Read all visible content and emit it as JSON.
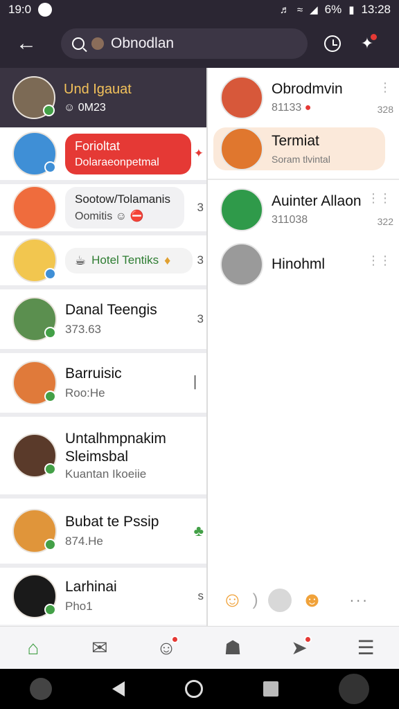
{
  "status_bar": {
    "time": "19:0",
    "battery": "6%",
    "clock": "13:28"
  },
  "app_bar": {
    "search_text": "Obnodlan"
  },
  "left_header": {
    "name": "Und Igauat",
    "sub": "0M23"
  },
  "left_rows": [
    {
      "bubble_title": "Forioltat",
      "bubble_sub": "Dolaraeonpetmal",
      "trail": "✦",
      "avatar_color": "#3f8fd6",
      "status_color": "#3f8fd6"
    },
    {
      "bubble_title": "Sootow/Tolamanis",
      "bubble_sub": "Oomitis",
      "trail": "3",
      "avatar_color": "#ef6c3d",
      "status_color": ""
    },
    {
      "bubble_title": "Hotel Tentiks",
      "trail": "3",
      "avatar_color": "#f2c64f",
      "status_color": "#3f8fd6"
    },
    {
      "title": "Danal Teengis",
      "sub": "373.63",
      "trail": "3",
      "avatar_color": "#5b8f4f",
      "status_color": "#43a047"
    },
    {
      "title": "Barruisic",
      "sub": "Roo:He",
      "trail": "▏",
      "avatar_color": "#e07a3a",
      "status_color": "#43a047"
    },
    {
      "title": "Untalhmpnakim Sleimsbal",
      "sub": "Kuantan Ikoeiie",
      "avatar_color": "#5a3a2a",
      "status_color": "#43a047"
    },
    {
      "title": "Bubat te Pssip",
      "sub": "874.He",
      "trail": "♣",
      "avatar_color": "#e0953a",
      "status_color": "#43a047"
    },
    {
      "title": "Larhinai",
      "sub": "Pho1",
      "trail": "s",
      "avatar_color": "#1a1a1a",
      "status_color": "#43a047"
    }
  ],
  "right_rows": [
    {
      "title": "Obrodmvin",
      "sub": "81133",
      "time": "328",
      "avatar_color": "#d7583a"
    },
    {
      "title": "Termiat",
      "sub": "Soram tlvintal",
      "avatar_color": "#e0772e",
      "selected": true
    },
    {
      "title": "Auinter Allaon",
      "sub": "311038",
      "time": "322",
      "avatar_color": "#2f9a4a"
    },
    {
      "title": "Hinohml",
      "avatar_color": "#9a9a9a"
    }
  ],
  "reactions": {
    "more": "···"
  },
  "bottom_nav": [
    {
      "icon": "home-icon",
      "glyph": "⌂",
      "active": true
    },
    {
      "icon": "chat-icon",
      "glyph": "✉"
    },
    {
      "icon": "person-icon",
      "glyph": "☺",
      "badge": true
    },
    {
      "icon": "ghost-icon",
      "glyph": "☗"
    },
    {
      "icon": "rocket-icon",
      "glyph": "➤",
      "badge": true
    },
    {
      "icon": "menu-icon",
      "glyph": "☰"
    }
  ],
  "colors": {
    "dark_bg": "#2b2633",
    "accent_red": "#e53935",
    "accent_green": "#43a047",
    "gold": "#f3c25b"
  }
}
